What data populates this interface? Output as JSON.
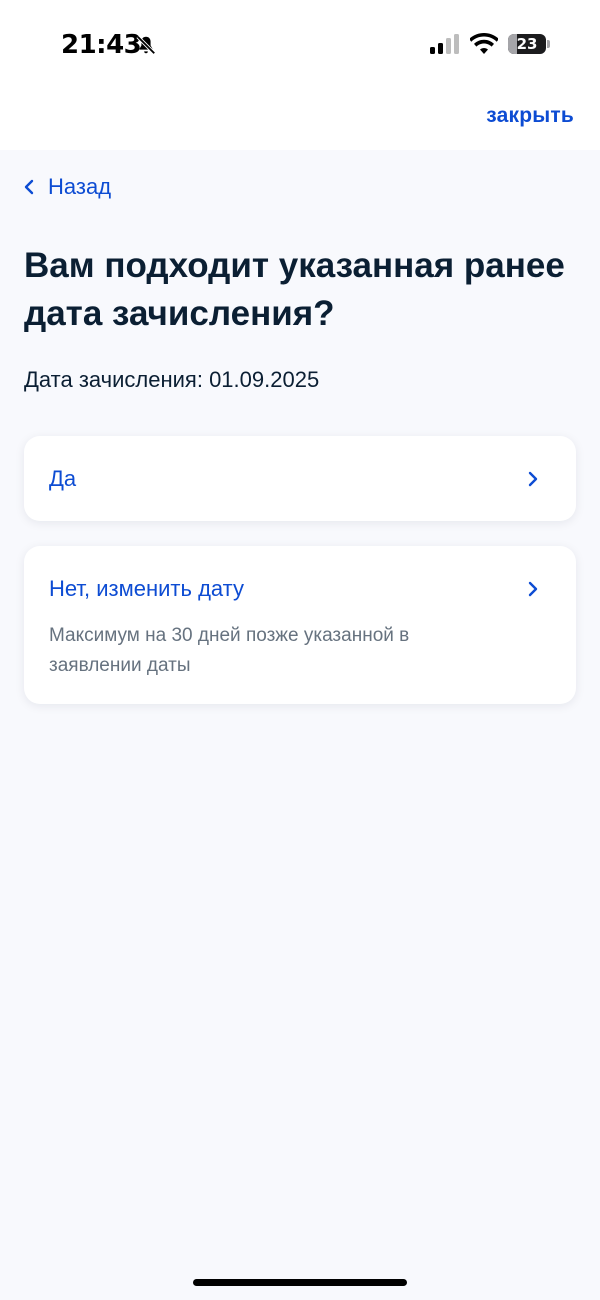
{
  "status_bar": {
    "time": "21:43",
    "battery_level": "23",
    "icons": [
      "bell-slash-icon",
      "cellular-signal-icon",
      "wifi-icon",
      "battery-icon"
    ]
  },
  "header": {
    "close_label": "закрыть"
  },
  "nav": {
    "back_label": "Назад"
  },
  "main": {
    "title": "Вам подходит указанная ранее дата зачисления?",
    "date_text": "Дата зачисления: 01.09.2025",
    "options": [
      {
        "label": "Да",
        "description": ""
      },
      {
        "label": "Нет, изменить дату",
        "description": "Максимум на 30 дней позже указанной в заявлении даты"
      }
    ]
  },
  "colors": {
    "accent": "#0d4cd3",
    "text": "#0b1f33",
    "muted": "#66727f",
    "background": "#f8f9fd"
  }
}
